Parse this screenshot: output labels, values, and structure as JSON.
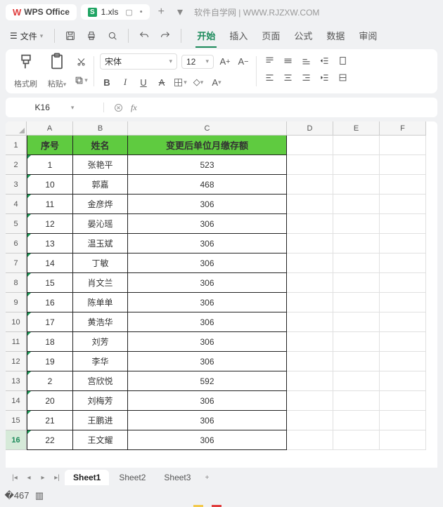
{
  "app": {
    "name": "WPS Office",
    "file_badge": "S",
    "file_name": "1.xls",
    "brand_text": "软件自学网 | WWW.RJZXW.COM"
  },
  "menus": {
    "file": "文件",
    "tabs": [
      "开始",
      "插入",
      "页面",
      "公式",
      "数据",
      "审阅"
    ],
    "active_tab": "开始"
  },
  "ribbon": {
    "format_brush": "格式刷",
    "paste": "粘贴",
    "font_name": "宋体",
    "font_size": "12"
  },
  "cell_ref": "K16",
  "fx_label": "fx",
  "columns": [
    "A",
    "B",
    "C",
    "D",
    "E",
    "F"
  ],
  "header_row": {
    "seq": "序号",
    "name": "姓名",
    "amount": "变更后单位月缴存额"
  },
  "rows": [
    {
      "r": "1",
      "seq": "1",
      "name": "张艳平",
      "amount": "523"
    },
    {
      "r": "2",
      "seq": "10",
      "name": "郭嘉",
      "amount": "468"
    },
    {
      "r": "3",
      "seq": "11",
      "name": "金彦烨",
      "amount": "306"
    },
    {
      "r": "4",
      "seq": "12",
      "name": "晏沁瑶",
      "amount": "306"
    },
    {
      "r": "5",
      "seq": "13",
      "name": "温玉斌",
      "amount": "306"
    },
    {
      "r": "6",
      "seq": "14",
      "name": "丁敏",
      "amount": "306"
    },
    {
      "r": "7",
      "seq": "15",
      "name": "肖文兰",
      "amount": "306"
    },
    {
      "r": "8",
      "seq": "16",
      "name": "陈单单",
      "amount": "306"
    },
    {
      "r": "9",
      "seq": "17",
      "name": "黄浩华",
      "amount": "306"
    },
    {
      "r": "10",
      "seq": "18",
      "name": "刘芳",
      "amount": "306"
    },
    {
      "r": "11",
      "seq": "19",
      "name": "李华",
      "amount": "306"
    },
    {
      "r": "12",
      "seq": "2",
      "name": "宫欣悦",
      "amount": "592"
    },
    {
      "r": "13",
      "seq": "20",
      "name": "刘梅芳",
      "amount": "306"
    },
    {
      "r": "14",
      "seq": "21",
      "name": "王鹏进",
      "amount": "306"
    },
    {
      "r": "15",
      "seq": "22",
      "name": "王文耀",
      "amount": "306"
    }
  ],
  "row_numbers": [
    "1",
    "2",
    "3",
    "4",
    "5",
    "6",
    "7",
    "8",
    "9",
    "10",
    "11",
    "12",
    "13",
    "14",
    "15",
    "16"
  ],
  "active_row": "16",
  "sheets": {
    "list": [
      "Sheet1",
      "Sheet2",
      "Sheet3"
    ],
    "active": "Sheet1"
  }
}
